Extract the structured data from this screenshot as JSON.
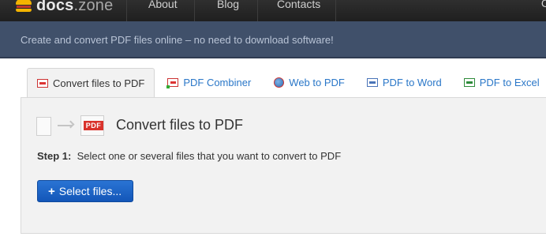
{
  "nav": {
    "logo_bold": "docs",
    "logo_rest": ".zone",
    "items": [
      "About",
      "Blog",
      "Contacts"
    ],
    "corner_glyph": "C"
  },
  "banner": {
    "text": "Create and convert PDF files online – no need to download software!"
  },
  "tabs": [
    {
      "label": "Convert files to PDF",
      "icon": "pdf-file-icon",
      "active": true
    },
    {
      "label": "PDF Combiner",
      "icon": "pdf-combiner-icon",
      "active": false
    },
    {
      "label": "Web to PDF",
      "icon": "web-globe-icon",
      "active": false
    },
    {
      "label": "PDF to Word",
      "icon": "word-file-icon",
      "active": false
    },
    {
      "label": "PDF to Excel",
      "icon": "excel-file-icon",
      "active": false
    }
  ],
  "panel": {
    "pdf_badge": "PDF",
    "title": "Convert files to PDF",
    "step_label": "Step 1:",
    "step_text": "Select one or several files that you want to convert to PDF",
    "select_button": "Select files...",
    "select_icon": "plus-icon"
  },
  "colors": {
    "accent_blue": "#1a62c6",
    "banner": "#40506a",
    "pdf_red": "#d9322b",
    "link_blue": "#2a77c8"
  }
}
